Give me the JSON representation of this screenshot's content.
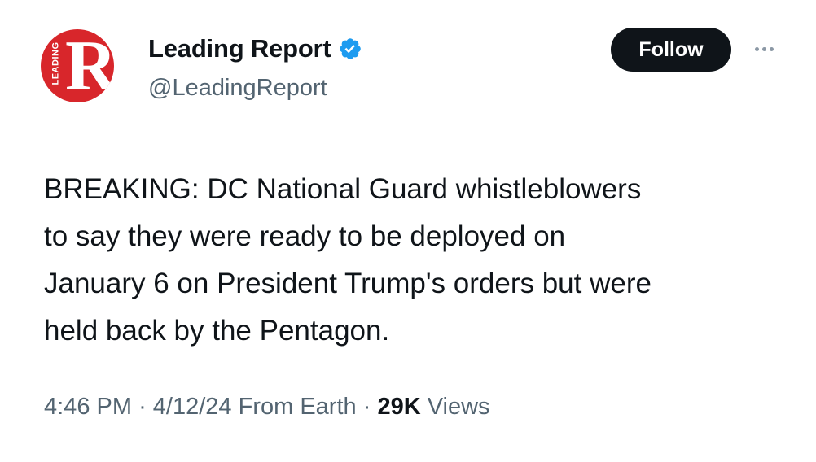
{
  "author": {
    "avatar_icon": "leading-report-logo",
    "avatar_letter": "R",
    "avatar_side_text": "LEADING",
    "brand_color": "#d8262b",
    "display_name": "Leading Report",
    "verified_icon": "verified-badge-icon",
    "verified_color": "#1d9bf0",
    "handle": "@LeadingReport"
  },
  "actions": {
    "follow_label": "Follow",
    "more_icon": "more-horizontal-icon"
  },
  "tweet": {
    "text": "BREAKING: DC National Guard whistleblowers\nto say they were ready to be deployed on\nJanuary 6 on President Trump's orders but were\nheld back by the Pentagon."
  },
  "meta": {
    "time": "4:46 PM",
    "date": "4/12/24",
    "source": "From Earth",
    "separator": "·",
    "views_count": "29K",
    "views_label": "Views"
  }
}
